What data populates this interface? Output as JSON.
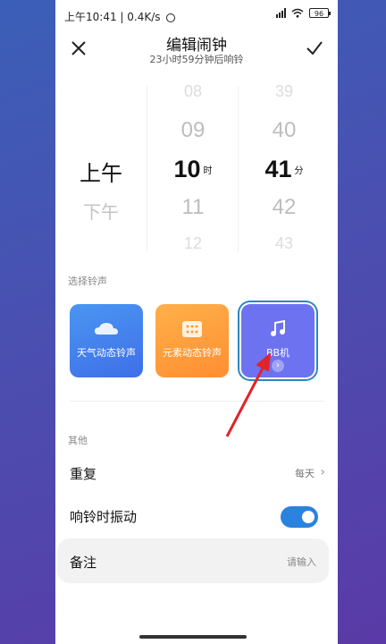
{
  "status_bar": {
    "time": "上午10:41",
    "speed": "0.4K/s",
    "battery": "96"
  },
  "header": {
    "title": "编辑闹钟",
    "subtitle": "23小时59分钟后响铃"
  },
  "picker": {
    "ampm": {
      "selected": "上午",
      "next": "下午"
    },
    "hours": {
      "items": [
        "08",
        "09",
        "10",
        "11",
        "12"
      ],
      "unit": "时"
    },
    "minutes": {
      "items": [
        "39",
        "40",
        "41",
        "42",
        "43"
      ],
      "unit": "分"
    }
  },
  "ringtone": {
    "label": "选择铃声",
    "cards": [
      {
        "label": "天气动态铃声",
        "icon": "cloud-icon",
        "color": "#4a8df0"
      },
      {
        "label": "元素动态铃声",
        "icon": "grid-icon",
        "color": "#ff9c3a"
      },
      {
        "label": "BB机",
        "icon": "music-note-icon",
        "color": "#6d72f0",
        "selected": true
      }
    ]
  },
  "other": {
    "label": "其他",
    "repeat": {
      "label": "重复",
      "value": "每天"
    },
    "vibrate": {
      "label": "响铃时振动",
      "on": true
    },
    "note": {
      "label": "备注",
      "placeholder": "请输入"
    }
  },
  "colors": {
    "accent": "#2a83de",
    "annotation_arrow": "#e0242a"
  }
}
